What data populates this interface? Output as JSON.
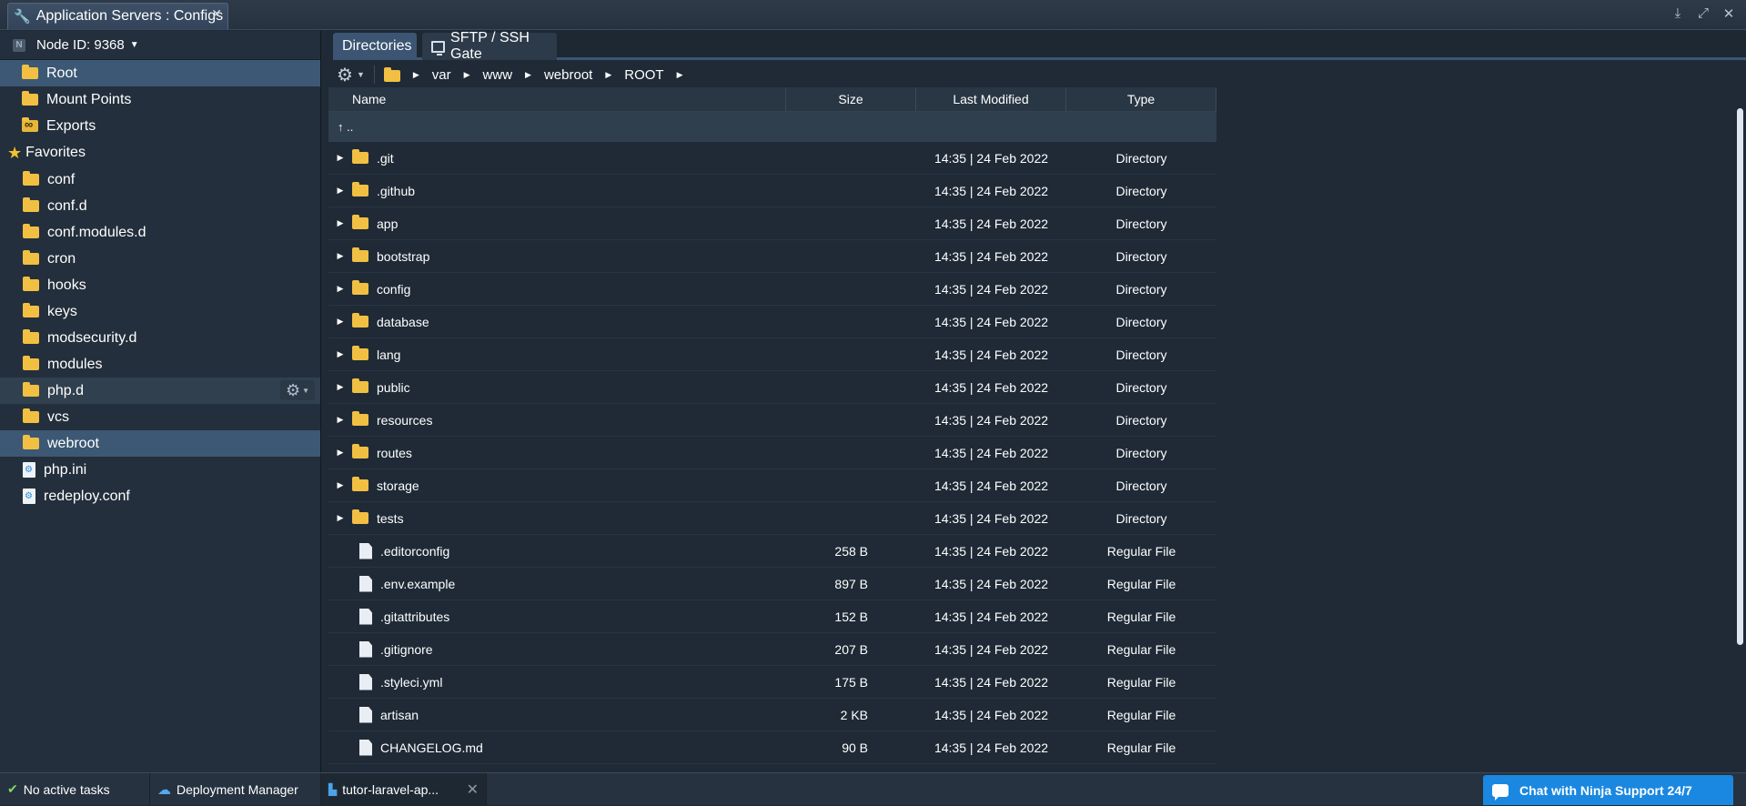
{
  "window": {
    "title": "Application Servers : Configs",
    "actions": [
      "download-icon",
      "expand-icon",
      "close-icon"
    ]
  },
  "sidebar": {
    "node_label": "Node ID: 9368",
    "root_items": [
      {
        "label": "Root",
        "icon": "folder-icon",
        "selected": true
      },
      {
        "label": "Mount Points",
        "icon": "folder-icon"
      },
      {
        "label": "Exports",
        "icon": "exports-folder-icon"
      }
    ],
    "favorites_label": "Favorites",
    "favorites": [
      {
        "label": "conf",
        "icon": "folder-icon"
      },
      {
        "label": "conf.d",
        "icon": "folder-icon"
      },
      {
        "label": "conf.modules.d",
        "icon": "folder-icon"
      },
      {
        "label": "cron",
        "icon": "folder-icon"
      },
      {
        "label": "hooks",
        "icon": "folder-icon"
      },
      {
        "label": "keys",
        "icon": "folder-icon"
      },
      {
        "label": "modsecurity.d",
        "icon": "folder-icon"
      },
      {
        "label": "modules",
        "icon": "folder-icon"
      },
      {
        "label": "php.d",
        "icon": "folder-icon",
        "hover": true
      },
      {
        "label": "vcs",
        "icon": "folder-icon"
      },
      {
        "label": "webroot",
        "icon": "folder-icon",
        "selected": true
      },
      {
        "label": "php.ini",
        "icon": "config-file-icon"
      },
      {
        "label": "redeploy.conf",
        "icon": "config-file-icon"
      }
    ]
  },
  "tabs": [
    {
      "label": "Directories",
      "active": true
    },
    {
      "label": "SFTP / SSH Gate",
      "active": false
    }
  ],
  "breadcrumb": [
    "var",
    "www",
    "webroot",
    "ROOT"
  ],
  "table": {
    "headers": {
      "name": "Name",
      "size": "Size",
      "modified": "Last Modified",
      "type": "Type"
    },
    "up_label": "↑ ..",
    "rows": [
      {
        "name": ".git",
        "size": "",
        "modified": "14:35 | 24 Feb 2022",
        "type": "Directory",
        "kind": "dir"
      },
      {
        "name": ".github",
        "size": "",
        "modified": "14:35 | 24 Feb 2022",
        "type": "Directory",
        "kind": "dir"
      },
      {
        "name": "app",
        "size": "",
        "modified": "14:35 | 24 Feb 2022",
        "type": "Directory",
        "kind": "dir"
      },
      {
        "name": "bootstrap",
        "size": "",
        "modified": "14:35 | 24 Feb 2022",
        "type": "Directory",
        "kind": "dir"
      },
      {
        "name": "config",
        "size": "",
        "modified": "14:35 | 24 Feb 2022",
        "type": "Directory",
        "kind": "dir"
      },
      {
        "name": "database",
        "size": "",
        "modified": "14:35 | 24 Feb 2022",
        "type": "Directory",
        "kind": "dir"
      },
      {
        "name": "lang",
        "size": "",
        "modified": "14:35 | 24 Feb 2022",
        "type": "Directory",
        "kind": "dir"
      },
      {
        "name": "public",
        "size": "",
        "modified": "14:35 | 24 Feb 2022",
        "type": "Directory",
        "kind": "dir"
      },
      {
        "name": "resources",
        "size": "",
        "modified": "14:35 | 24 Feb 2022",
        "type": "Directory",
        "kind": "dir"
      },
      {
        "name": "routes",
        "size": "",
        "modified": "14:35 | 24 Feb 2022",
        "type": "Directory",
        "kind": "dir"
      },
      {
        "name": "storage",
        "size": "",
        "modified": "14:35 | 24 Feb 2022",
        "type": "Directory",
        "kind": "dir"
      },
      {
        "name": "tests",
        "size": "",
        "modified": "14:35 | 24 Feb 2022",
        "type": "Directory",
        "kind": "dir"
      },
      {
        "name": ".editorconfig",
        "size": "258 B",
        "modified": "14:35 | 24 Feb 2022",
        "type": "Regular File",
        "kind": "file"
      },
      {
        "name": ".env.example",
        "size": "897 B",
        "modified": "14:35 | 24 Feb 2022",
        "type": "Regular File",
        "kind": "file"
      },
      {
        "name": ".gitattributes",
        "size": "152 B",
        "modified": "14:35 | 24 Feb 2022",
        "type": "Regular File",
        "kind": "file"
      },
      {
        "name": ".gitignore",
        "size": "207 B",
        "modified": "14:35 | 24 Feb 2022",
        "type": "Regular File",
        "kind": "file"
      },
      {
        "name": ".styleci.yml",
        "size": "175 B",
        "modified": "14:35 | 24 Feb 2022",
        "type": "Regular File",
        "kind": "file"
      },
      {
        "name": "artisan",
        "size": "2 KB",
        "modified": "14:35 | 24 Feb 2022",
        "type": "Regular File",
        "kind": "file"
      },
      {
        "name": "CHANGELOG.md",
        "size": "90 B",
        "modified": "14:35 | 24 Feb 2022",
        "type": "Regular File",
        "kind": "file"
      }
    ]
  },
  "bottom": {
    "tasks_label": "No active tasks",
    "deploy_label": "Deployment Manager",
    "env_label": "tutor-laravel-ap...",
    "chat_label": "Chat with Ninja Support 24/7"
  },
  "colors": {
    "accent": "#3b5572",
    "folder": "#f1c043",
    "chat": "#1a88e0"
  }
}
